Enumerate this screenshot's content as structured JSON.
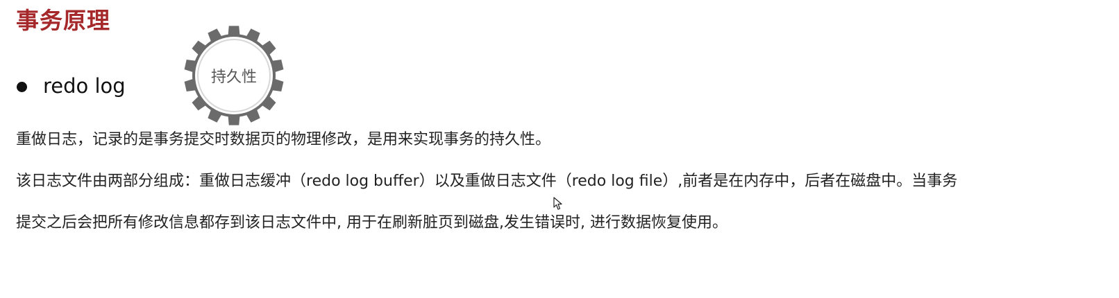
{
  "header": {
    "title": "事务原理"
  },
  "bullet": {
    "label": "redo log"
  },
  "badge": {
    "label": "持久性",
    "icon": "gear-icon",
    "color": "#6b6b6b"
  },
  "paragraphs": [
    "重做日志，记录的是事务提交时数据页的物理修改，是用来实现事务的持久性。",
    "该日志文件由两部分组成：重做日志缓冲（redo log buffer）以及重做日志文件（redo log file）,前者是在内存中，后者在磁盘中。当事务",
    "提交之后会把所有修改信息都存到该日志文件中, 用于在刷新脏页到磁盘,发生错误时, 进行数据恢复使用。"
  ],
  "colors": {
    "title": "#a5282a",
    "text": "#222222"
  }
}
